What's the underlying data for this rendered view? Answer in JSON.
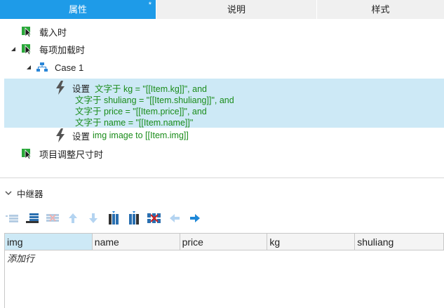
{
  "tabs": [
    {
      "label": "属性",
      "modified_mark": "*"
    },
    {
      "label": "说明"
    },
    {
      "label": "样式"
    }
  ],
  "events": {
    "load": {
      "label": "载入时"
    },
    "item_load": {
      "label": "每项加载时"
    },
    "case": {
      "label": "Case 1"
    },
    "action1": {
      "keyword": "设置",
      "lines": [
        "文字于 kg = \"[[Item.kg]]\", and",
        "文字于 shuliang = \"[[Item.shuliang]]\", and",
        "文字于 price = \"[[Item.price]]\", and",
        "文字于 name = \"[[Item.name]]\""
      ]
    },
    "action2": {
      "keyword": "设置",
      "text": "img image to [[Item.img]]"
    },
    "item_resize": {
      "label": "项目调整尺寸时"
    }
  },
  "repeater": {
    "title": "中继器",
    "toolbar": [
      {
        "icon": "insert-row-above-icon",
        "enabled": false
      },
      {
        "icon": "insert-row-below-icon",
        "enabled": true
      },
      {
        "icon": "delete-row-icon",
        "enabled": false
      },
      {
        "icon": "move-up-icon",
        "enabled": false
      },
      {
        "icon": "move-down-icon",
        "enabled": false
      },
      {
        "icon": "insert-column-left-icon",
        "enabled": true
      },
      {
        "icon": "insert-column-right-icon",
        "enabled": true
      },
      {
        "icon": "delete-column-icon",
        "enabled": true
      },
      {
        "icon": "move-left-icon",
        "enabled": false
      },
      {
        "icon": "move-right-icon",
        "enabled": true
      }
    ],
    "columns": [
      "img",
      "name",
      "price",
      "kg",
      "shuliang"
    ],
    "add_row_label": "添加行"
  },
  "colors": {
    "accent": "#1e9be8",
    "selection": "#cde9f6",
    "event_green": "#2aa83a",
    "action_text": "#1a8c1a"
  }
}
